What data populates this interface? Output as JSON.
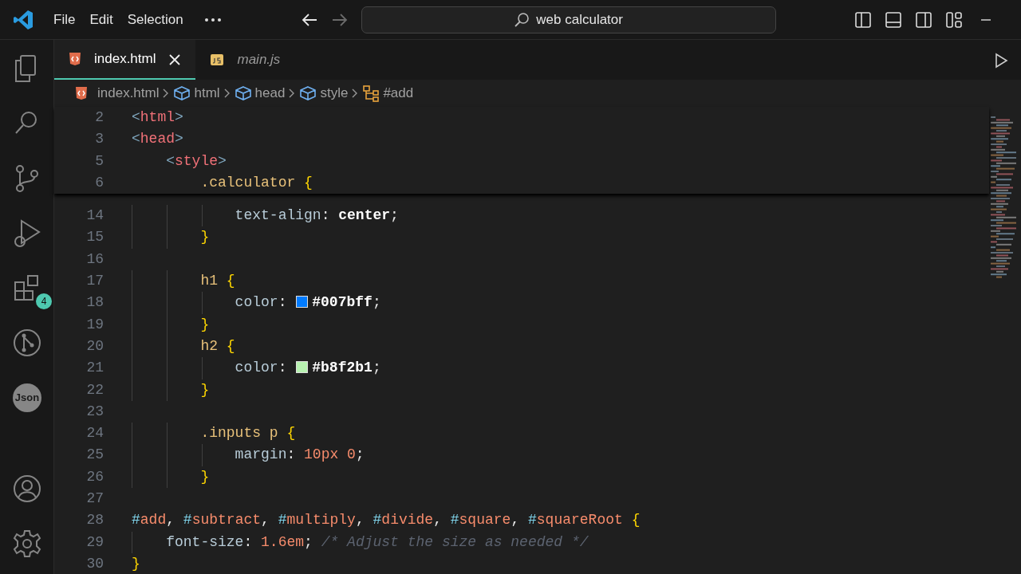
{
  "title_bar": {
    "menu": [
      "File",
      "Edit",
      "Selection"
    ],
    "back_disabled": false,
    "forward_disabled": true,
    "search": "web calculator"
  },
  "activity_bar": {
    "top": [
      {
        "kind": "explorer"
      },
      {
        "kind": "search"
      },
      {
        "kind": "source-control"
      },
      {
        "kind": "run-debug"
      },
      {
        "kind": "extensions",
        "badge": "4"
      },
      {
        "kind": "git-graph"
      },
      {
        "kind": "json",
        "label": "Json"
      }
    ],
    "bottom": [
      {
        "kind": "account"
      },
      {
        "kind": "settings"
      }
    ]
  },
  "tabs": [
    {
      "label": "index.html",
      "kind": "html",
      "selected": true,
      "preview": false
    },
    {
      "label": "main.js",
      "kind": "js",
      "selected": false,
      "preview": true
    }
  ],
  "breadcrumb": [
    {
      "label": "index.html",
      "kind": "html"
    },
    {
      "label": "html",
      "kind": "element"
    },
    {
      "label": "head",
      "kind": "element"
    },
    {
      "label": "style",
      "kind": "element"
    },
    {
      "label": "#add",
      "kind": "symbol"
    }
  ],
  "sticky_lines": [
    {
      "number": "2",
      "tokens": [
        {
          "kind": "bracket",
          "text": "<"
        },
        {
          "kind": "tag",
          "text": "html"
        },
        {
          "kind": "bracket",
          "text": ">"
        }
      ]
    },
    {
      "number": "3",
      "tokens": [
        {
          "kind": "bracket",
          "text": "<"
        },
        {
          "kind": "tag",
          "text": "head"
        },
        {
          "kind": "bracket",
          "text": ">"
        }
      ]
    },
    {
      "number": "5",
      "tokens": [
        {
          "kind": "bracket",
          "text": "    <"
        },
        {
          "kind": "tag",
          "text": "style"
        },
        {
          "kind": "bracket",
          "text": ">"
        }
      ]
    },
    {
      "number": "6",
      "tokens": [
        {
          "kind": "selector",
          "text": "        .calculator "
        },
        {
          "kind": "brace",
          "text": "{"
        }
      ]
    }
  ],
  "lines": [
    {
      "number": "14",
      "tokens": [
        {
          "kind": "property",
          "text": "            text-align"
        },
        {
          "kind": "punct",
          "text": ": "
        },
        {
          "kind": "value",
          "text": "center"
        },
        {
          "kind": "punct",
          "text": ";"
        }
      ]
    },
    {
      "number": "15",
      "tokens": [
        {
          "kind": "brace",
          "text": "        }"
        }
      ]
    },
    {
      "number": "16"
    },
    {
      "number": "17",
      "tokens": [
        {
          "kind": "selector",
          "text": "        h1 "
        },
        {
          "kind": "brace",
          "text": "{"
        }
      ]
    },
    {
      "number": "18",
      "tokens": [
        {
          "kind": "property",
          "text": "            color"
        },
        {
          "kind": "punct",
          "text": ": "
        },
        {
          "kind": "swatch",
          "color": "#007bff"
        },
        {
          "kind": "value",
          "text": "#007bff"
        },
        {
          "kind": "punct",
          "text": ";"
        }
      ]
    },
    {
      "number": "19",
      "tokens": [
        {
          "kind": "brace",
          "text": "        }"
        }
      ]
    },
    {
      "number": "20",
      "tokens": [
        {
          "kind": "selector",
          "text": "        h2 "
        },
        {
          "kind": "brace",
          "text": "{"
        }
      ]
    },
    {
      "number": "21",
      "tokens": [
        {
          "kind": "property",
          "text": "            color"
        },
        {
          "kind": "punct",
          "text": ": "
        },
        {
          "kind": "swatch",
          "color": "#b8f2b1"
        },
        {
          "kind": "value",
          "text": "#b8f2b1"
        },
        {
          "kind": "punct",
          "text": ";"
        }
      ]
    },
    {
      "number": "22",
      "tokens": [
        {
          "kind": "brace",
          "text": "        }"
        }
      ]
    },
    {
      "number": "23"
    },
    {
      "number": "24",
      "tokens": [
        {
          "kind": "selector",
          "text": "        .inputs p "
        },
        {
          "kind": "brace",
          "text": "{"
        }
      ]
    },
    {
      "number": "25",
      "tokens": [
        {
          "kind": "property",
          "text": "            margin"
        },
        {
          "kind": "punct",
          "text": ": "
        },
        {
          "kind": "number",
          "text": "10px 0"
        },
        {
          "kind": "punct",
          "text": ";"
        }
      ]
    },
    {
      "number": "26",
      "tokens": [
        {
          "kind": "brace",
          "text": "        }"
        }
      ]
    },
    {
      "number": "27"
    },
    {
      "number": "28",
      "tokens": [
        {
          "kind": "idhash",
          "text": "#"
        },
        {
          "kind": "idname",
          "text": "add"
        },
        {
          "kind": "punct",
          "text": ", "
        },
        {
          "kind": "idhash",
          "text": "#"
        },
        {
          "kind": "idname",
          "text": "subtract"
        },
        {
          "kind": "punct",
          "text": ", "
        },
        {
          "kind": "idhash",
          "text": "#"
        },
        {
          "kind": "idname",
          "text": "multiply"
        },
        {
          "kind": "punct",
          "text": ", "
        },
        {
          "kind": "idhash",
          "text": "#"
        },
        {
          "kind": "idname",
          "text": "divide"
        },
        {
          "kind": "punct",
          "text": ", "
        },
        {
          "kind": "idhash",
          "text": "#"
        },
        {
          "kind": "idname",
          "text": "square"
        },
        {
          "kind": "punct",
          "text": ", "
        },
        {
          "kind": "idhash",
          "text": "#"
        },
        {
          "kind": "idname",
          "text": "squareRoot"
        },
        {
          "kind": "brace",
          "text": " {"
        }
      ]
    },
    {
      "number": "29",
      "tokens": [
        {
          "kind": "property",
          "text": "    font-size"
        },
        {
          "kind": "punct",
          "text": ": "
        },
        {
          "kind": "number",
          "text": "1.6em"
        },
        {
          "kind": "punct",
          "text": ";"
        },
        {
          "kind": "comment",
          "text": " /* Adjust the size as needed */"
        }
      ]
    },
    {
      "number": "30",
      "tokens": [
        {
          "kind": "brace",
          "text": "}"
        }
      ]
    }
  ]
}
